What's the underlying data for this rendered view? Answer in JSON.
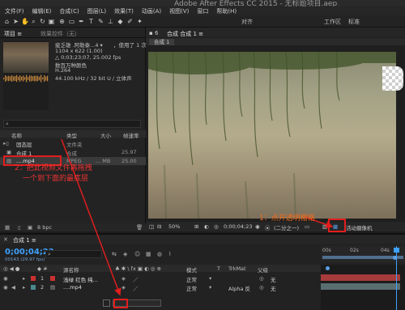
{
  "title": "Adobe After Effects CC 2015 - 无标题项目.aep",
  "menu": [
    "文件(F)",
    "编辑(E)",
    "合成(C)",
    "图层(L)",
    "效果(T)",
    "动画(A)",
    "视图(V)",
    "窗口",
    "帮助(H)"
  ],
  "toolbar": {
    "snap_label": "对齐",
    "workspace_left": "工作区",
    "workspace_right": "标准"
  },
  "project_panel": {
    "tab_project": "项目 ≡",
    "tab_effects": "效果控件（无）",
    "footage_name": "疲乏雄 .阿勒泰...4 ▾",
    "usage": "，使用了 1 次",
    "dims": "1104 x 622 (1.00)",
    "duration": "△ 0;03;23;07, 25.002 fps",
    "colors": "数百万种颜色",
    "codec": "H.264",
    "audio": "44.100 kHz / 32 bit U / 立体声",
    "search_icon": "⌕",
    "columns": [
      "名称",
      "类型",
      "大小",
      "帧速率"
    ],
    "items": [
      {
        "name": "固态层",
        "type": "文件夹",
        "size": "",
        "fps": ""
      },
      {
        "name": "合成 1",
        "type": "合成",
        "size": "",
        "fps": "25.97"
      },
      {
        "name": "....mp4",
        "type": "MPEG",
        "size": "... MB",
        "fps": "25.00"
      }
    ],
    "footer": "8 bpc"
  },
  "comp_panel": {
    "tab": "合成 合成 1 ≡",
    "subtab": "合成 1",
    "zoom": "50%",
    "timecode": "0;00;04;23",
    "resolution": "(二分之一)",
    "camera": "活动摄像机"
  },
  "timeline": {
    "tab": "合成 1 ≡",
    "timecode": "0;00;04;23",
    "fps": "00143 (29.97 fps)",
    "columns": [
      "源名称",
      "模式",
      "T",
      "TrkMat",
      "父级"
    ],
    "layers": [
      {
        "index": "1",
        "color": "#c9312f",
        "name": "浅绿 红色 纯...",
        "mode": "正常",
        "trkmat": "",
        "parent": "无"
      },
      {
        "index": "2",
        "color": "#4a8a8f",
        "name": "....mp4",
        "mode": "正常",
        "trkmat": "Alpha 反",
        "parent": "无"
      }
    ],
    "ruler": [
      "00s",
      "02s",
      "04s"
    ]
  },
  "annotations": {
    "step1": "1：点开透明栅格",
    "step2_line1": "2：把此视频文件再拖拽",
    "step2_line2": "一个到下面的最底层"
  },
  "colors": {
    "annotation_red": "#e11d1d",
    "timecode_blue": "#3ea1ff"
  }
}
